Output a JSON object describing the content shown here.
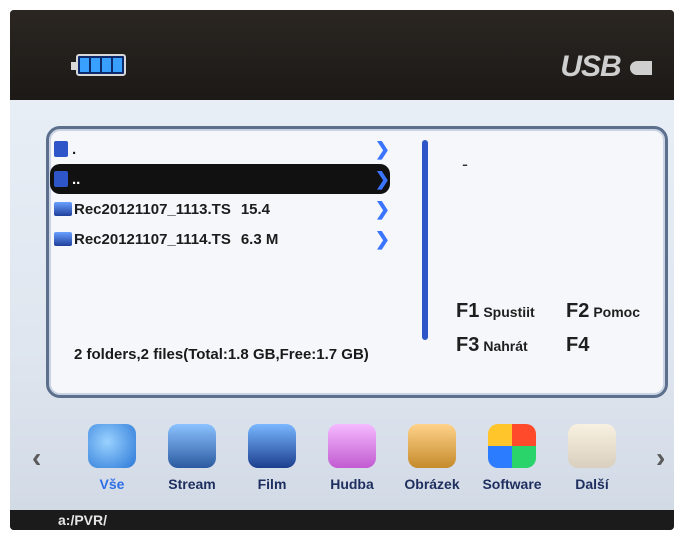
{
  "status": {
    "battery_icon": "battery-full-icon",
    "usb_label": "USB"
  },
  "files": [
    {
      "type": "folder",
      "name": ".",
      "size": ""
    },
    {
      "type": "folder",
      "name": "..",
      "size": "",
      "selected": true
    },
    {
      "type": "file",
      "name": "Rec20121107_1113.TS",
      "size": "15.4"
    },
    {
      "type": "file",
      "name": "Rec20121107_1114.TS",
      "size": "6.3 M"
    }
  ],
  "info_dash": "-",
  "summary": "2 folders,2 files(Total:1.8 GB,Free:1.7 GB)",
  "fkeys": [
    {
      "key": "F1",
      "label": "Spustiit"
    },
    {
      "key": "F2",
      "label": "Pomoc"
    },
    {
      "key": "F3",
      "label": "Nahrát"
    },
    {
      "key": "F4",
      "label": ""
    }
  ],
  "categories": [
    {
      "id": "vse",
      "label": "Vše",
      "icon": "globe-icon",
      "active": true
    },
    {
      "id": "stream",
      "label": "Stream",
      "icon": "stream-icon"
    },
    {
      "id": "film",
      "label": "Film",
      "icon": "film-icon"
    },
    {
      "id": "hudba",
      "label": "Hudba",
      "icon": "music-icon"
    },
    {
      "id": "obrazek",
      "label": "Obrázek",
      "icon": "image-icon"
    },
    {
      "id": "software",
      "label": "Software",
      "icon": "software-icon"
    },
    {
      "id": "dalsi",
      "label": "Další",
      "icon": "document-icon"
    }
  ],
  "path": "a:/PVR/"
}
